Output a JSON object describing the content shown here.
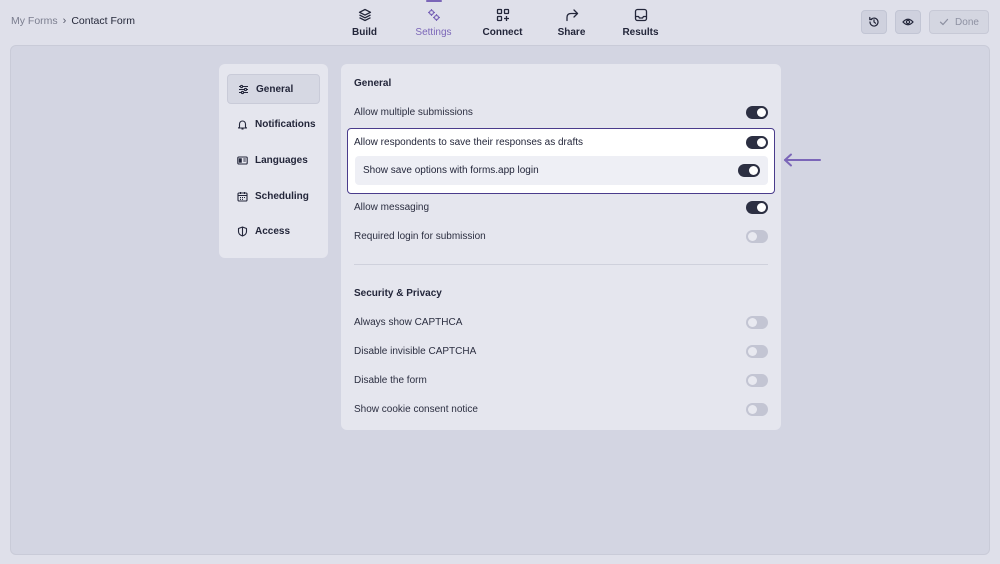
{
  "breadcrumb": {
    "root": "My Forms",
    "separator": "›",
    "current": "Contact Form"
  },
  "nav": {
    "tabs": [
      {
        "label": "Build",
        "icon": "layers-icon"
      },
      {
        "label": "Settings",
        "icon": "gears-icon",
        "active": true
      },
      {
        "label": "Connect",
        "icon": "grid-plus-icon"
      },
      {
        "label": "Share",
        "icon": "share-arrow-icon"
      },
      {
        "label": "Results",
        "icon": "inbox-icon"
      }
    ]
  },
  "actions": {
    "history_icon": "history-icon",
    "preview_icon": "eye-icon",
    "done_label": "Done"
  },
  "sidebar": {
    "items": [
      {
        "label": "General",
        "icon": "sliders-icon",
        "active": true
      },
      {
        "label": "Notifications",
        "icon": "bell-icon"
      },
      {
        "label": "Languages",
        "icon": "language-icon"
      },
      {
        "label": "Scheduling",
        "icon": "calendar-icon"
      },
      {
        "label": "Access",
        "icon": "shield-icon"
      }
    ]
  },
  "general": {
    "title": "General",
    "allow_multiple": {
      "label": "Allow multiple submissions",
      "on": true
    },
    "save_drafts": {
      "label": "Allow respondents to save their responses as drafts",
      "on": true
    },
    "save_options": {
      "label": "Show save options with forms.app login",
      "on": true
    },
    "allow_messaging": {
      "label": "Allow messaging",
      "on": true
    },
    "required_login": {
      "label": "Required login for submission",
      "on": false
    }
  },
  "security": {
    "title": "Security & Privacy",
    "always_captcha": {
      "label": "Always show CAPTHCA",
      "on": false
    },
    "disable_invisible": {
      "label": "Disable invisible CAPTCHA",
      "on": false
    },
    "disable_form": {
      "label": "Disable the form",
      "on": false
    },
    "cookie_notice": {
      "label": "Show cookie consent notice",
      "on": false
    }
  },
  "colors": {
    "accent": "#7b66b8",
    "highlight_border": "#4a3c8c",
    "toggle_on": "#2c2f42",
    "toggle_off": "#c3c5d3"
  }
}
